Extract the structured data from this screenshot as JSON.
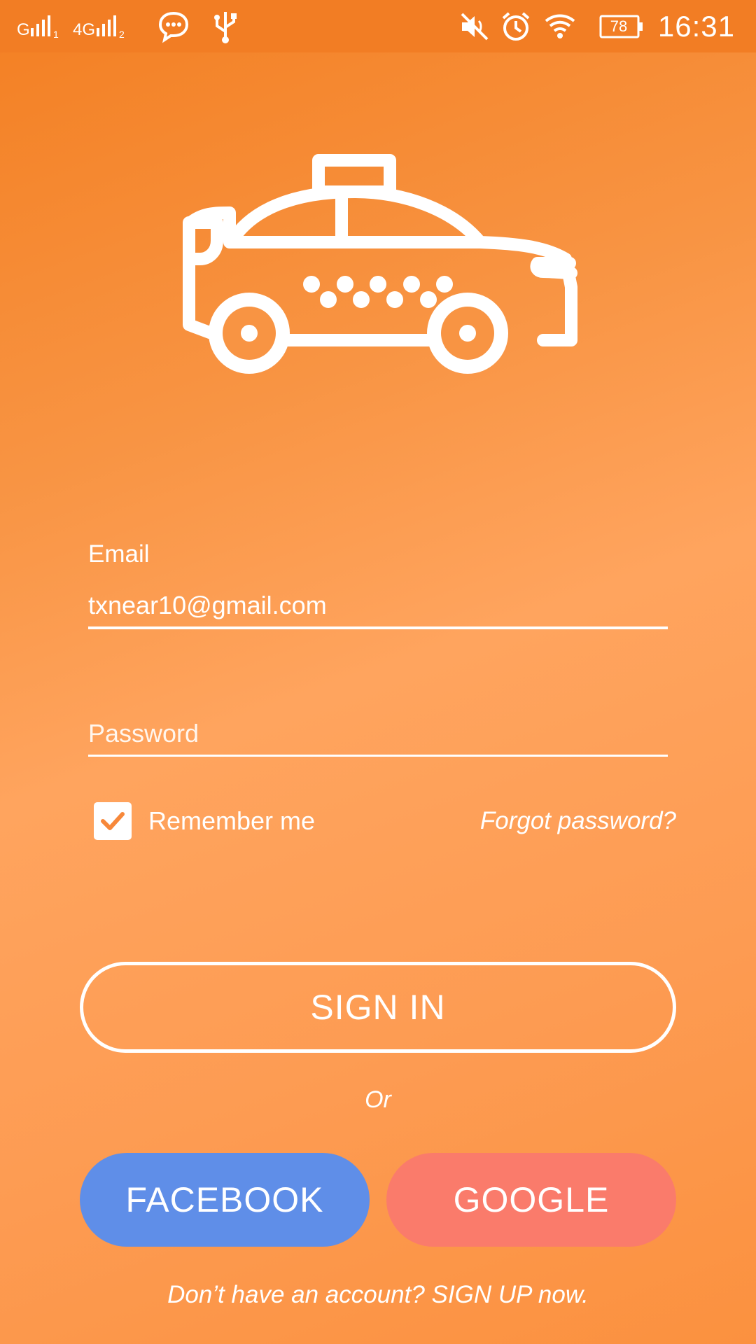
{
  "status_bar": {
    "signal_1": "G",
    "signal_2": "4G",
    "battery": "78",
    "time": "16:31",
    "icons": [
      "signal-icon",
      "signal-icon",
      "message-icon",
      "usb-icon",
      "mute-icon",
      "alarm-icon",
      "wifi-icon",
      "battery-icon"
    ]
  },
  "logo": {
    "icon": "taxi-icon"
  },
  "form": {
    "email_label": "Email",
    "email_value": "txnear10@gmail.com",
    "password_placeholder": "Password",
    "remember_label": "Remember me",
    "remember_checked": true,
    "forgot_label": "Forgot password?"
  },
  "actions": {
    "signin_label": "SIGN IN",
    "or_label": "Or",
    "facebook_label": "FACEBOOK",
    "google_label": "GOOGLE",
    "signup_text": "Don’t have an account? SIGN UP now."
  },
  "colors": {
    "background": "#f89443",
    "facebook": "#5f8ee8",
    "google": "#fa7b6b",
    "checkmark": "#f7883a"
  }
}
